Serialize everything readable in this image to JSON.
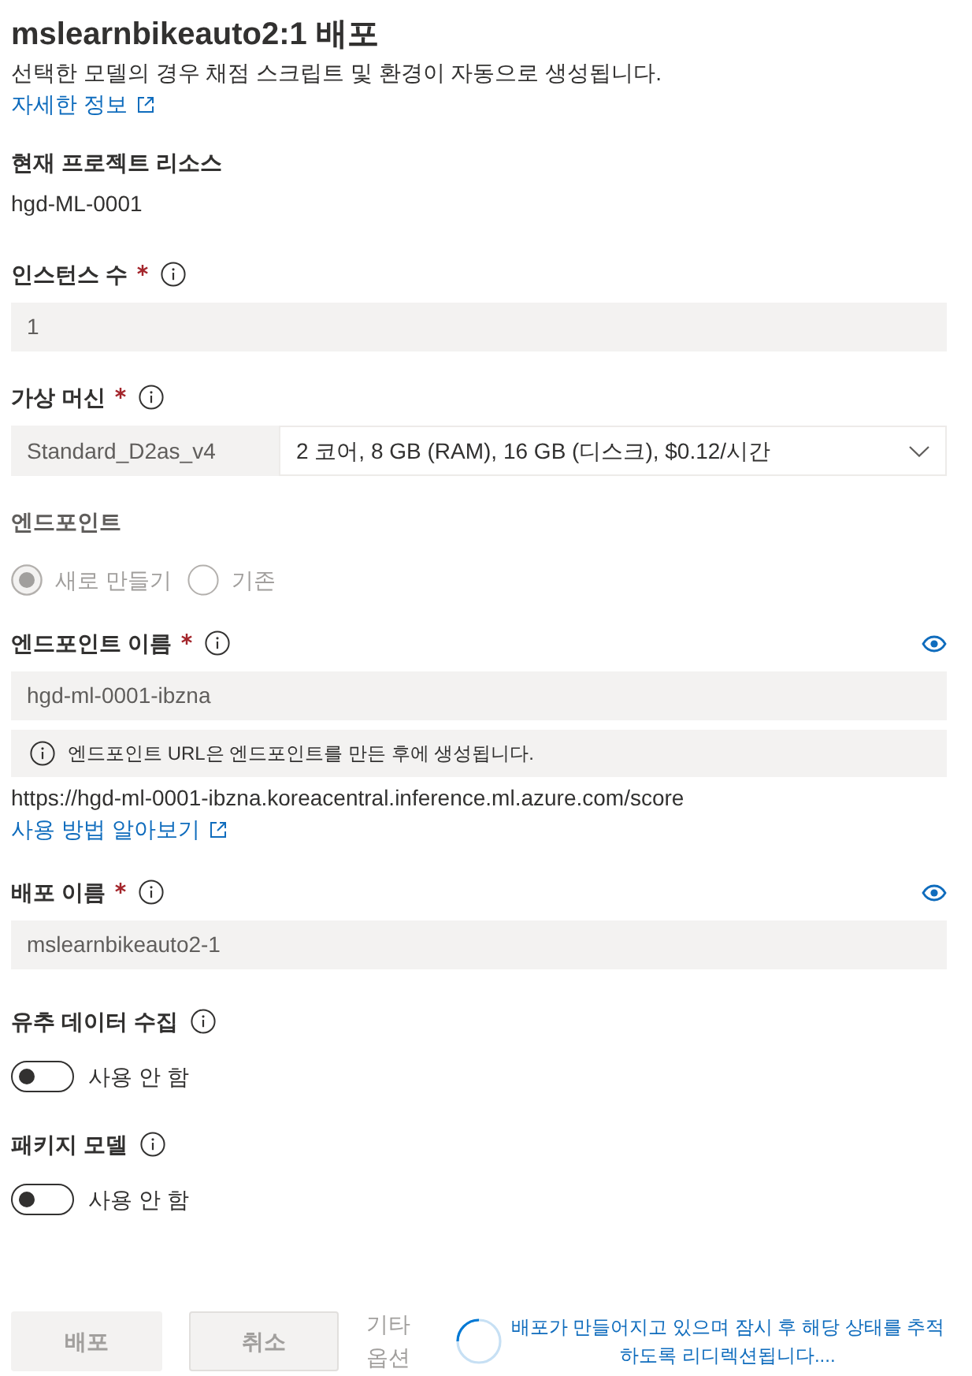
{
  "title": "mslearnbikeauto2:1 배포",
  "description": "선택한 모델의 경우 채점 스크립트 및 환경이 자동으로 생성됩니다.",
  "learn_more_link": "자세한 정보",
  "project_resource": {
    "label": "현재 프로젝트 리소스",
    "value": "hgd-ML-0001"
  },
  "sections": [
    {
      "kind": "input",
      "label": "인스턴스 수",
      "required": true,
      "info": true,
      "visibility_toggle": false,
      "value": "1",
      "disabled": true
    },
    {
      "kind": "vm_select",
      "label": "가상 머신",
      "required": true,
      "info": true,
      "size": "Standard_D2as_v4",
      "spec": "2 코어, 8 GB (RAM), 16 GB (디스크), $0.12/시간"
    },
    {
      "kind": "radio_group",
      "label": "엔드포인트",
      "required": false,
      "info": false,
      "disabled": true,
      "options": [
        {
          "label": "새로 만들기",
          "selected": true
        },
        {
          "label": "기존",
          "selected": false
        }
      ]
    },
    {
      "kind": "input",
      "label": "엔드포인트 이름",
      "required": true,
      "info": true,
      "visibility_toggle": true,
      "value": "hgd-ml-0001-ibzna",
      "disabled": true,
      "notice": "엔드포인트 URL은 엔드포인트를 만든 후에 생성됩니다.",
      "url": "https://hgd-ml-0001-ibzna.koreacentral.inference.ml.azure.com/score",
      "help_link": "사용 방법 알아보기"
    },
    {
      "kind": "input",
      "label": "배포 이름",
      "required": true,
      "info": true,
      "visibility_toggle": true,
      "value": "mslearnbikeauto2-1",
      "disabled": true
    },
    {
      "kind": "toggle",
      "label": "유추 데이터 수집",
      "required": false,
      "info": true,
      "on": false,
      "state_text": "사용 안 함"
    },
    {
      "kind": "toggle",
      "label": "패키지 모델",
      "required": false,
      "info": true,
      "on": false,
      "state_text": "사용 안 함"
    }
  ],
  "footer": {
    "buttons": [
      {
        "kind": "primary",
        "label": "배포",
        "disabled": true
      },
      {
        "kind": "default",
        "label": "취소",
        "disabled": true
      }
    ],
    "more_options": {
      "label": "기타 옵션",
      "disabled": true
    },
    "status": "배포가 만들어지고 있으며 잠시 후 해당 상태를 추적하도록 리디렉션됩니다...."
  }
}
